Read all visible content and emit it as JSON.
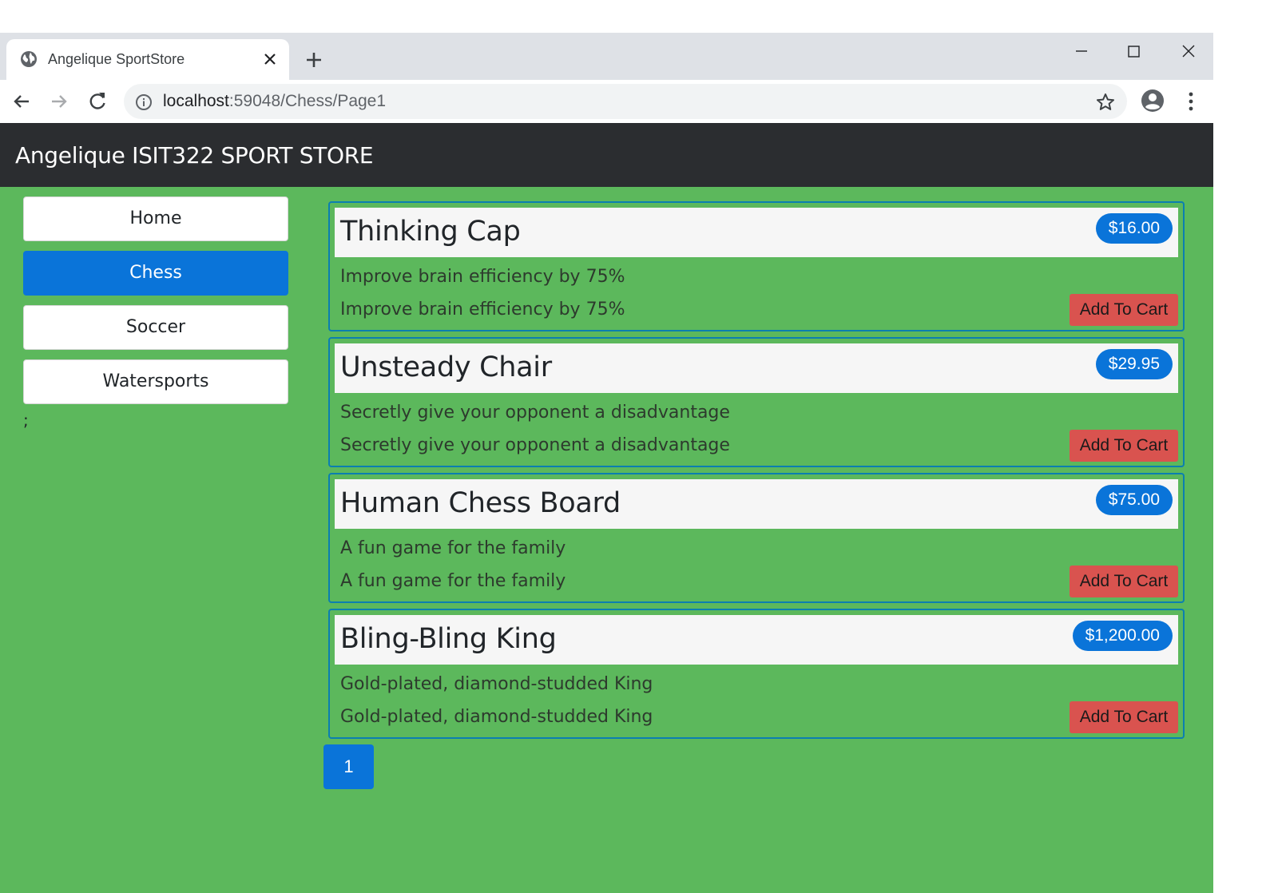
{
  "browser": {
    "tab_title": "Angelique SportStore",
    "url_host": "localhost",
    "url_rest": ":59048/Chess/Page1"
  },
  "site": {
    "brand": "Angelique ISIT322 SPORT STORE"
  },
  "sidebar": {
    "items": [
      {
        "label": "Home",
        "active": false
      },
      {
        "label": "Chess",
        "active": true
      },
      {
        "label": "Soccer",
        "active": false
      },
      {
        "label": "Watersports",
        "active": false
      }
    ],
    "trailing_text": ";"
  },
  "products": [
    {
      "name": "Thinking Cap",
      "price": "$16.00",
      "description": "Improve brain efficiency by 75%",
      "button": "Add To Cart"
    },
    {
      "name": "Unsteady Chair",
      "price": "$29.95",
      "description": "Secretly give your opponent a disadvantage",
      "button": "Add To Cart"
    },
    {
      "name": "Human Chess Board",
      "price": "$75.00",
      "description": "A fun game for the family",
      "button": "Add To Cart"
    },
    {
      "name": "Bling-Bling King",
      "price": "$1,200.00",
      "description": "Gold-plated, diamond-studded King",
      "button": "Add To Cart"
    }
  ],
  "pagination": {
    "pages": [
      "1"
    ],
    "current": "1"
  },
  "colors": {
    "page_background": "#5cb85c",
    "header_background": "#2b2d30",
    "primary": "#0a74d9",
    "danger": "#d9534f",
    "card_border": "#0b7fb0"
  }
}
